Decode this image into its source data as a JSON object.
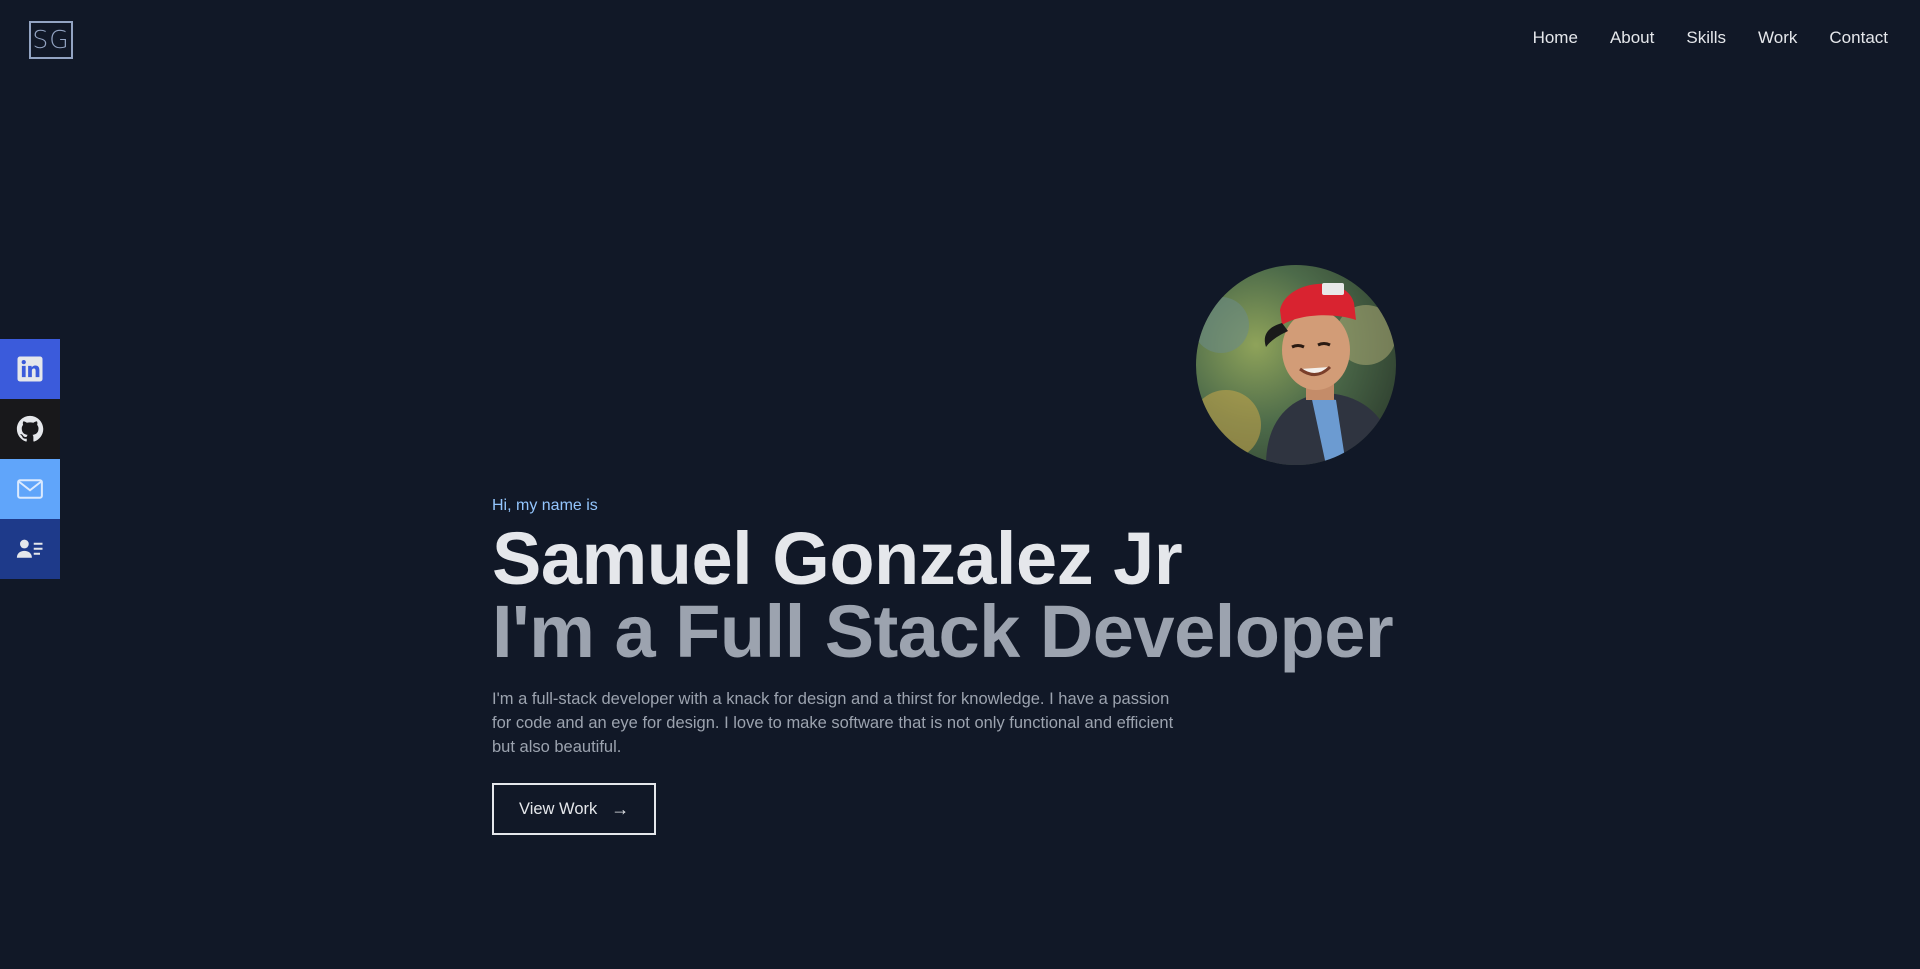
{
  "header": {
    "logo_text": "SG",
    "nav": [
      {
        "label": "Home"
      },
      {
        "label": "About"
      },
      {
        "label": "Skills"
      },
      {
        "label": "Work"
      },
      {
        "label": "Contact"
      }
    ]
  },
  "social": [
    {
      "icon": "linkedin-icon",
      "color": "#3b5bdb"
    },
    {
      "icon": "github-icon",
      "color": "#18181b"
    },
    {
      "icon": "mail-icon",
      "color": "#60a5fa"
    },
    {
      "icon": "resume-icon",
      "color": "#1e3a8a"
    }
  ],
  "hero": {
    "greeting": "Hi, my name is",
    "name": "Samuel Gonzalez Jr",
    "role": "I'm a Full Stack Developer",
    "description": "I'm a full-stack developer with a knack for design and a thirst for knowledge. I have a passion for code and an eye for design. I love to make software that is not only functional and efficient but also beautiful.",
    "cta_label": "View Work",
    "cta_icon": "arrow-right-icon"
  },
  "colors": {
    "background": "#111827",
    "accent": "#93c5fd",
    "heading": "#e5e7eb",
    "muted": "#9ca3af"
  }
}
